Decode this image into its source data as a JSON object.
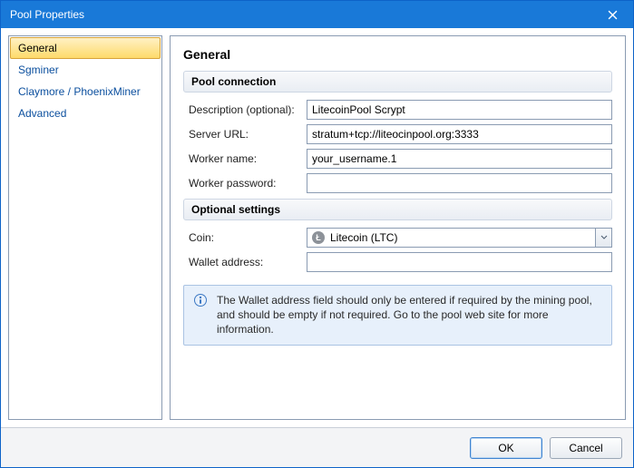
{
  "window": {
    "title": "Pool Properties"
  },
  "sidebar": {
    "items": [
      {
        "label": "General",
        "selected": true
      },
      {
        "label": "Sgminer",
        "selected": false
      },
      {
        "label": "Claymore / PhoenixMiner",
        "selected": false
      },
      {
        "label": "Advanced",
        "selected": false
      }
    ]
  },
  "main": {
    "heading": "General",
    "group_connection": "Pool connection",
    "group_optional": "Optional settings",
    "labels": {
      "description": "Description (optional):",
      "server_url": "Server URL:",
      "worker_name": "Worker name:",
      "worker_password": "Worker password:",
      "coin": "Coin:",
      "wallet": "Wallet address:"
    },
    "values": {
      "description": "LitecoinPool Scrypt",
      "server_url": "stratum+tcp://liteocinpool.org:3333",
      "worker_name": "your_username.1",
      "worker_password": "",
      "coin": "Litecoin (LTC)",
      "wallet": ""
    },
    "info": "The Wallet address field should only be entered if required by the mining pool, and should be empty if not required. Go to the pool web site for more information."
  },
  "footer": {
    "ok": "OK",
    "cancel": "Cancel"
  }
}
